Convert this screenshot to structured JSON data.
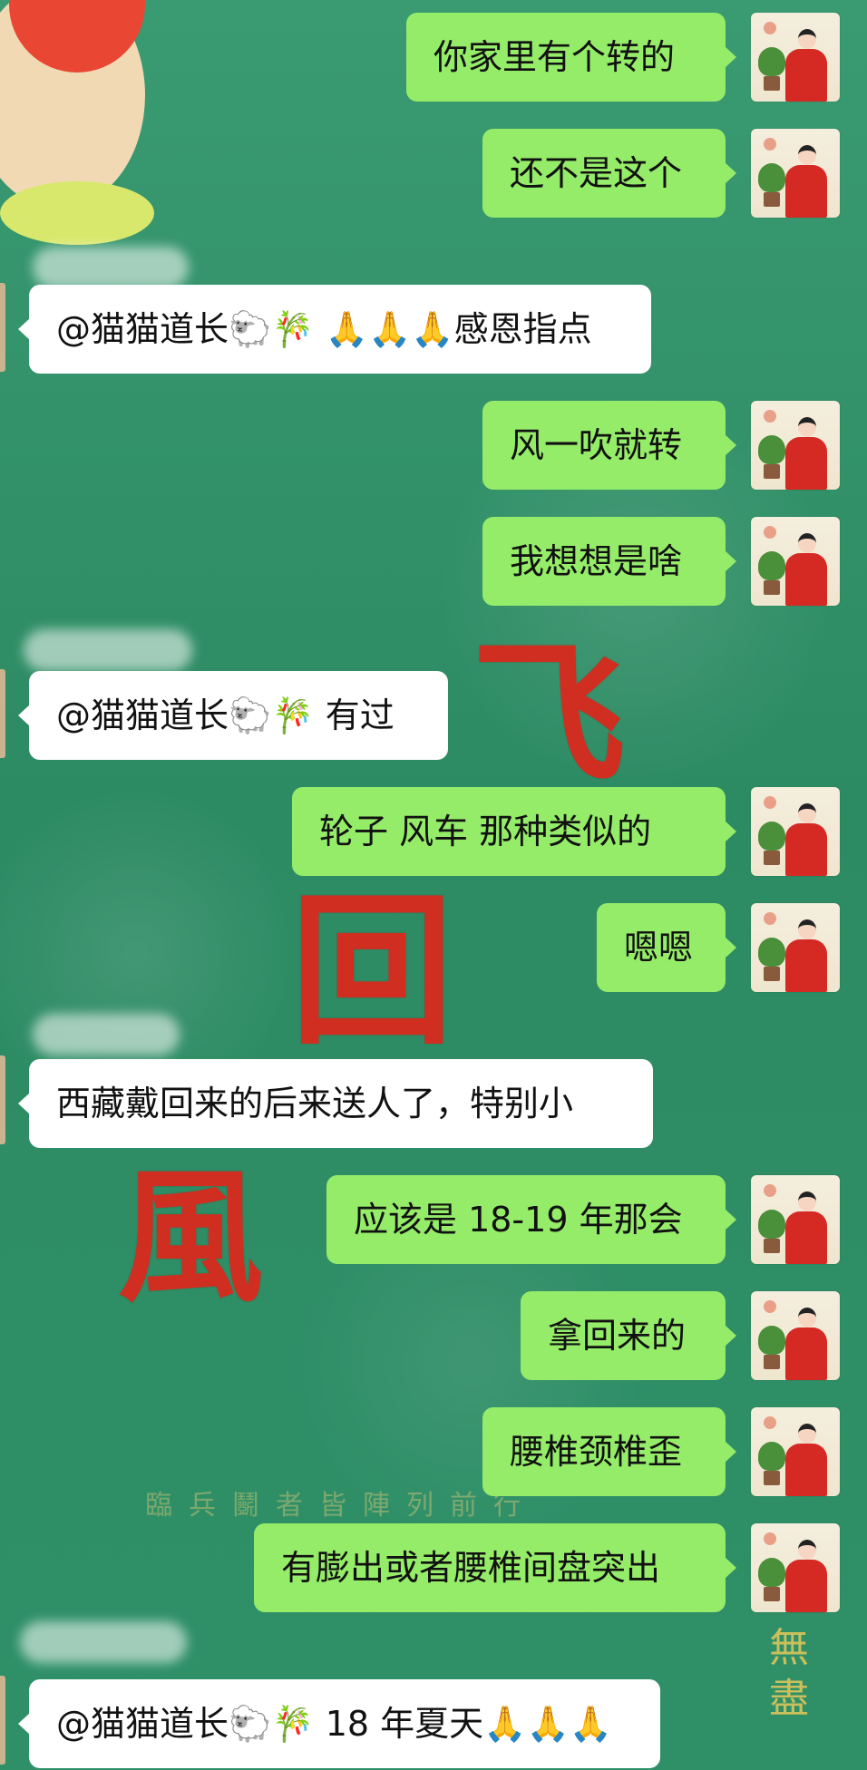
{
  "messages": [
    {
      "side": "right",
      "text": "你家里有个转的"
    },
    {
      "side": "right",
      "text": "还不是这个"
    },
    {
      "side": "left",
      "text": "@猫猫道长🐑🎋 🙏🙏🙏感恩指点"
    },
    {
      "side": "right",
      "text": "风一吹就转"
    },
    {
      "side": "right",
      "text": "我想想是啥"
    },
    {
      "side": "left",
      "text": "@猫猫道长🐑🎋 有过"
    },
    {
      "side": "right",
      "text": "轮子  风车  那种类似的"
    },
    {
      "side": "right",
      "text": "嗯嗯"
    },
    {
      "side": "left",
      "text": "西藏戴回来的后来送人了，特别小"
    },
    {
      "side": "right",
      "text": "应该是 18-19 年那会"
    },
    {
      "side": "right",
      "text": "拿回来的"
    },
    {
      "side": "right",
      "text": "腰椎颈椎歪"
    },
    {
      "side": "right",
      "text": "有膨出或者腰椎间盘突出"
    },
    {
      "side": "left",
      "text": "@猫猫道长🐑🎋 18 年夏天🙏🙏🙏"
    }
  ],
  "background": {
    "chars": [
      "飞",
      "回",
      "風"
    ],
    "line_text": "臨兵鬭者皆陣列前行",
    "gold_text": "無盡"
  },
  "colors": {
    "right_bubble": "#95ec69",
    "left_bubble": "#ffffff",
    "background": "#2f8f68"
  }
}
